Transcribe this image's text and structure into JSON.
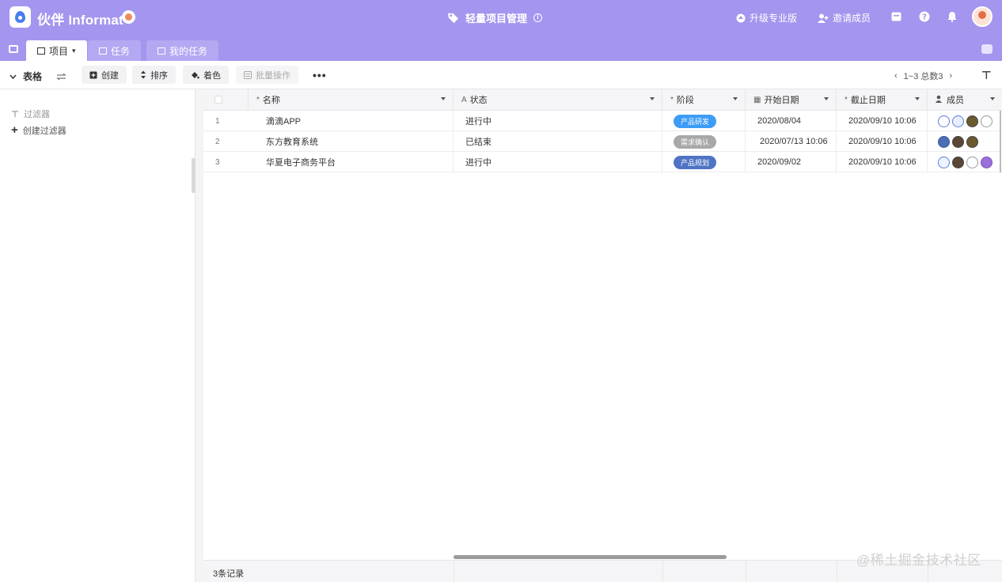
{
  "header": {
    "brand": "伙伴 Informat",
    "app_title": "轻量项目管理",
    "actions": [
      {
        "label": "升级专业版",
        "icon": "upgrade-icon"
      },
      {
        "label": "邀请成员",
        "icon": "add-user-icon"
      }
    ],
    "colors": {
      "header_bg": "#a495ef",
      "tab_inactive": "#b3a8f2"
    }
  },
  "tabs": [
    {
      "label": "项目",
      "suffix": "▾",
      "active": true
    },
    {
      "label": "任务",
      "active": false
    },
    {
      "label": "我的任务",
      "active": false
    }
  ],
  "toolbar": {
    "view_label": "表格",
    "buttons": [
      {
        "label": "创建",
        "icon": "create-icon"
      },
      {
        "label": "排序",
        "icon": "sort-icon"
      },
      {
        "label": "着色",
        "icon": "color-icon"
      },
      {
        "label": "批量操作",
        "icon": "batch-icon",
        "disabled": true
      }
    ],
    "more": "•••",
    "pager": "1~3 总数3"
  },
  "sidebar": {
    "filter_label": "过滤器",
    "add_filter_label": "创建过滤器"
  },
  "grid": {
    "columns": [
      {
        "label": "名称",
        "icon": "*"
      },
      {
        "label": "状态",
        "icon": "A"
      },
      {
        "label": "阶段",
        "icon": "*"
      },
      {
        "label": "开始日期",
        "icon": "▦"
      },
      {
        "label": "截止日期",
        "icon": "*"
      },
      {
        "label": "成员",
        "icon": "👤"
      }
    ],
    "rows": [
      {
        "num": "1",
        "name": "滴滴APP",
        "status": "进行中",
        "stage": "产品研发",
        "stage_color": "#3d9cf5",
        "start": "2020/08/04",
        "end": "2020/09/10 10:06",
        "members": [
          "#ffffff",
          "#e8eefc",
          "#6b5a2e",
          "#ffffff"
        ]
      },
      {
        "num": "2",
        "name": "东方教育系统",
        "status": "已结束",
        "stage": "需求确认",
        "stage_color": "#a8a8a8",
        "start": "2020/07/13 10:06",
        "end": "2020/09/10 10:06",
        "members": [
          "#4a6fb5",
          "#5b4636",
          "#6b5a2e"
        ]
      },
      {
        "num": "3",
        "name": "华夏电子商务平台",
        "status": "进行中",
        "stage": "产品规划",
        "stage_color": "#4f74c4",
        "start": "2020/09/02",
        "end": "2020/09/10 10:06",
        "members": [
          "#eef3ff",
          "#5b4636",
          "#ffffff",
          "#9b6fd9"
        ]
      }
    ],
    "footer": "3条记录"
  },
  "watermark": "@稀土掘金技术社区"
}
